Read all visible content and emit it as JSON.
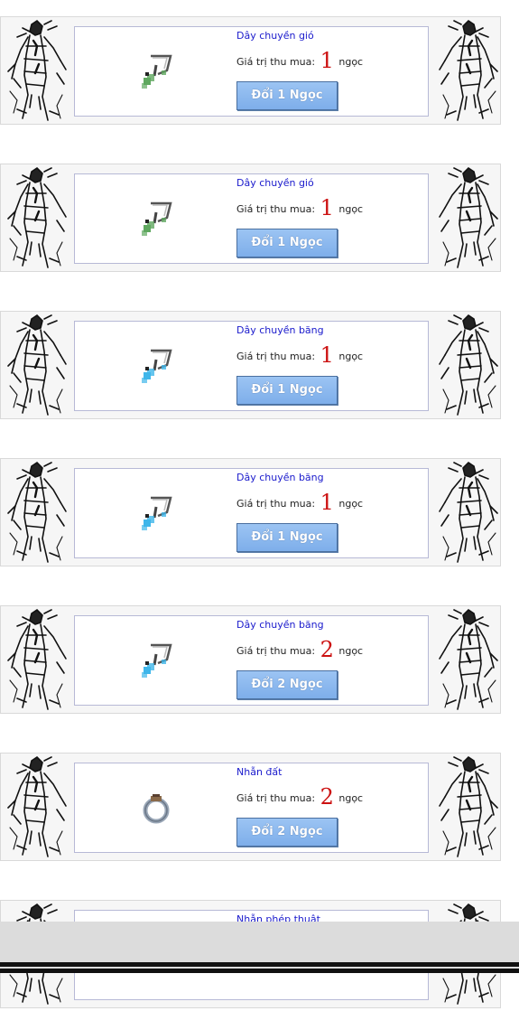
{
  "items": [
    {
      "name": "Dây chuyền gió",
      "price_label": "Giá trị thu mua:",
      "price": "1",
      "unit": "ngọc",
      "button": "Đổi 1 Ngọc",
      "icon": "wind-necklace-icon",
      "gem": "#5fa85f"
    },
    {
      "name": "Dây chuyền gió",
      "price_label": "Giá trị thu mua:",
      "price": "1",
      "unit": "ngọc",
      "button": "Đổi 1 Ngọc",
      "icon": "wind-necklace-icon",
      "gem": "#5fa85f"
    },
    {
      "name": "Dây chuyền băng",
      "price_label": "Giá trị thu mua:",
      "price": "1",
      "unit": "ngọc",
      "button": "Đổi 1 Ngọc",
      "icon": "ice-necklace-icon",
      "gem": "#3fb6ea"
    },
    {
      "name": "Dây chuyền băng",
      "price_label": "Giá trị thu mua:",
      "price": "1",
      "unit": "ngọc",
      "button": "Đổi 1 Ngọc",
      "icon": "ice-necklace-icon",
      "gem": "#3fb6ea"
    },
    {
      "name": "Dây chuyền băng",
      "price_label": "Giá trị thu mua:",
      "price": "2",
      "unit": "ngọc",
      "button": "Đổi 2 Ngọc",
      "icon": "ice-necklace-icon",
      "gem": "#3fb6ea"
    },
    {
      "name": "Nhẫn đất",
      "price_label": "Giá trị thu mua:",
      "price": "2",
      "unit": "ngọc",
      "button": "Đổi 2 Ngọc",
      "icon": "earth-ring-icon",
      "gem": "#8a6a4a"
    },
    {
      "name": "Nhẫn phép thuật",
      "price_label": "Giá trị thu mua:",
      "price": "",
      "unit": "",
      "button": "",
      "icon": "magic-ring-icon",
      "gem": "#8a6a4a"
    }
  ]
}
